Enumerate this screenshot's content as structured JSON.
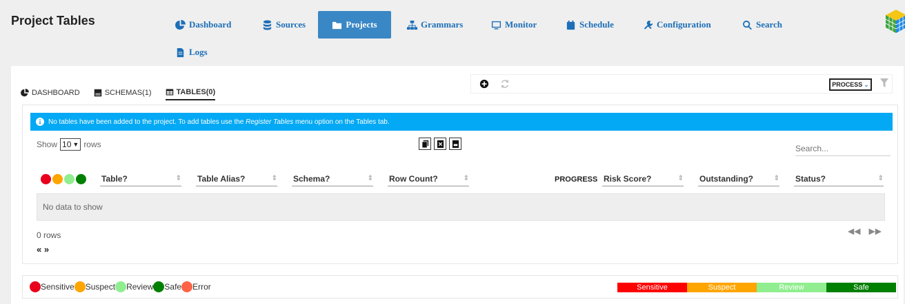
{
  "app": {
    "title": "Project Tables"
  },
  "nav": {
    "items": [
      {
        "label": "Dashboard",
        "icon": "pie-chart-icon"
      },
      {
        "label": "Sources",
        "icon": "database-icon"
      },
      {
        "label": "Projects",
        "icon": "folder-icon",
        "active": true
      },
      {
        "label": "Grammars",
        "icon": "sitemap-icon"
      },
      {
        "label": "Monitor",
        "icon": "monitor-icon"
      },
      {
        "label": "Schedule",
        "icon": "calendar-icon"
      },
      {
        "label": "Configuration",
        "icon": "tools-icon"
      },
      {
        "label": "Search",
        "icon": "search-icon"
      },
      {
        "label": "Logs",
        "icon": "file-icon"
      }
    ]
  },
  "subtabs": [
    {
      "label": "DASHBOARD",
      "icon": "pie-chart-icon"
    },
    {
      "label": "SCHEMAS(1)",
      "icon": "schema-icon"
    },
    {
      "label": "TABLES(0)",
      "icon": "table-icon",
      "active": true
    }
  ],
  "toolbar": {
    "process_label": "PROCESS"
  },
  "alert": {
    "text_before": "No tables have been added to the project. To add tables use the ",
    "emphasis": "Register Tables",
    "text_after": " menu option on the Tables tab."
  },
  "table": {
    "show_label": "Show",
    "rows_value": "10",
    "rows_label": "rows",
    "search_placeholder": "Search...",
    "columns": [
      "Table?",
      "Table Alias?",
      "Schema?",
      "Row Count?",
      "Risk Score?",
      "Outstanding?",
      "Status?"
    ],
    "progress_label": "PROGRESS",
    "empty_text": "No data to show",
    "count_text": "0 rows",
    "pager_text": "« »"
  },
  "legend": {
    "items": [
      {
        "label": "Sensitive",
        "color": "#e8001c"
      },
      {
        "label": "Suspect",
        "color": "#ffa500"
      },
      {
        "label": "Review",
        "color": "#90ee90"
      },
      {
        "label": "Safe",
        "color": "#008000"
      },
      {
        "label": "Error",
        "color": "#ff6347"
      }
    ],
    "scale": [
      {
        "label": "Sensitive",
        "color": "#ff0000"
      },
      {
        "label": "Suspect",
        "color": "#ffa500"
      },
      {
        "label": "Review",
        "color": "#90ee90"
      },
      {
        "label": "Safe",
        "color": "#008000"
      }
    ]
  },
  "status_dots": [
    "#e8001c",
    "#ffa500",
    "#90ee90",
    "#008000"
  ]
}
